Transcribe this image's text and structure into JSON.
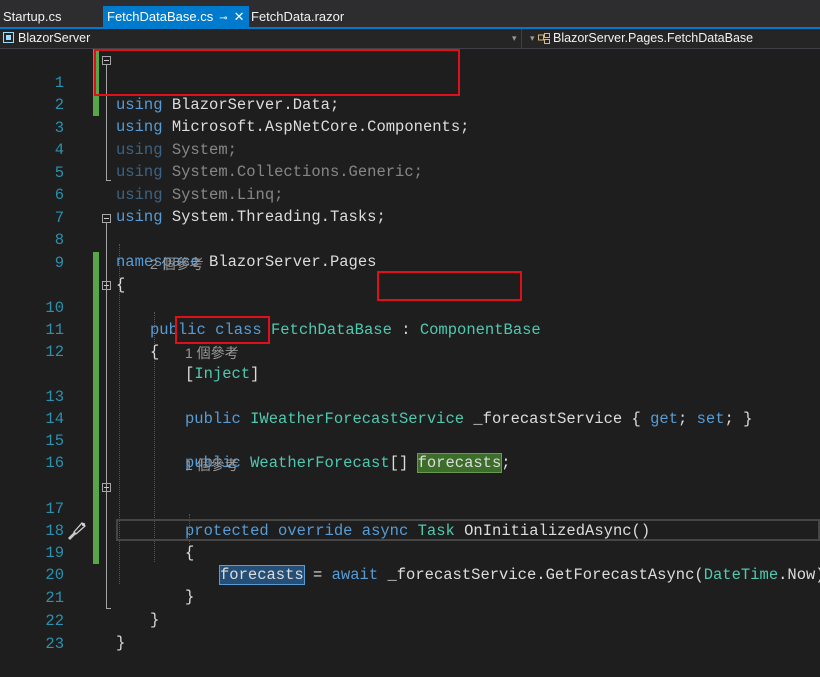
{
  "tabs": [
    {
      "label": "Startup.cs",
      "active": false
    },
    {
      "label": "FetchDataBase.cs",
      "active": true,
      "pin": "⊸",
      "close": "✕"
    },
    {
      "label": "FetchData.razor",
      "active": false
    }
  ],
  "nav": {
    "project": "BlazorServer",
    "class_path": "BlazorServer.Pages.FetchDataBase"
  },
  "code_lens": {
    "class_refs": "2 個參考",
    "inject_refs": "1 個參考",
    "method_refs": "1 個參考"
  },
  "code": {
    "l1": {
      "ln": "1",
      "kw": "using",
      "rest": " BlazorServer.Data;"
    },
    "l2": {
      "ln": "2",
      "kw": "using",
      "rest": " Microsoft.AspNetCore.Components;"
    },
    "l3": {
      "ln": "3",
      "kw": "using",
      "rest": " System;"
    },
    "l4": {
      "ln": "4",
      "kw": "using",
      "rest": " System.Collections.Generic;"
    },
    "l5": {
      "ln": "5",
      "kw": "using",
      "rest": " System.Linq;"
    },
    "l6": {
      "ln": "6",
      "kw": "using",
      "rest": " System.Threading.Tasks;"
    },
    "l7": {
      "ln": "7"
    },
    "l8": {
      "ln": "8",
      "kw": "namespace",
      "rest": " BlazorServer.Pages"
    },
    "l9": {
      "ln": "9",
      "rest": "{"
    },
    "l10": {
      "ln": "10",
      "kw1": "public",
      "kw2": "class",
      "name": "FetchDataBase",
      "colon": ":",
      "base": "ComponentBase"
    },
    "l11": {
      "ln": "11",
      "rest": "{"
    },
    "l12": {
      "ln": "12",
      "open": "[",
      "attr": "Inject",
      "close": "]"
    },
    "l13": {
      "ln": "13",
      "kw": "public",
      "type": "IWeatherForecastService",
      "field": " _forecastService",
      "ob": " { ",
      "get": "get",
      "semi1": "; ",
      "set": "set",
      "cb": "; }"
    },
    "l14": {
      "ln": "14"
    },
    "l15": {
      "ln": "15",
      "kw": "public",
      "type": "WeatherForecast",
      "arr": "[] ",
      "name": "forecasts",
      "semi": ";"
    },
    "l16": {
      "ln": "16"
    },
    "l17": {
      "ln": "17",
      "kw1": "protected",
      "kw2": "override",
      "kw3": "async",
      "type": "Task",
      "method": " OnInitializedAsync()"
    },
    "l18": {
      "ln": "18",
      "rest": "{"
    },
    "l19": {
      "ln": "19",
      "var": "forecasts",
      "eq": " = ",
      "kw": "await",
      "call": " _forecastService.GetForecastAsync(",
      "type": "DateTime",
      "tail": ".Now);"
    },
    "l20": {
      "ln": "20",
      "rest": "}"
    },
    "l21": {
      "ln": "21",
      "rest": "}"
    },
    "l22": {
      "ln": "22",
      "rest": "}"
    },
    "l23": {
      "ln": "23"
    }
  },
  "colors": {
    "keyword": "#569cd6",
    "type": "#4ec9b0",
    "line_number": "#2b91af",
    "annotation_box": "#e0101a",
    "active_tab": "#007acc",
    "change_bar": "#57a64a"
  }
}
